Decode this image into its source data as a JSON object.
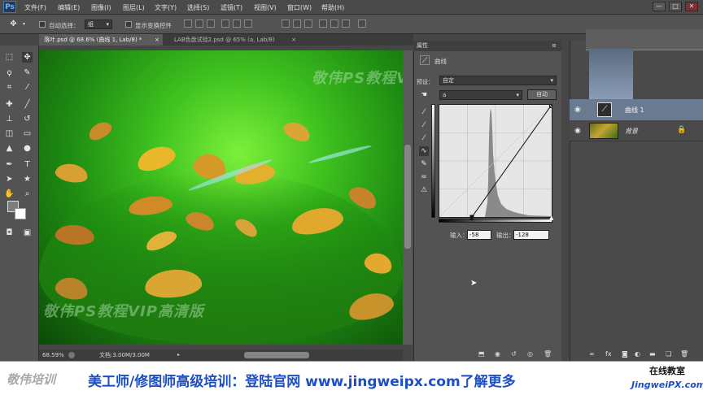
{
  "app": {
    "logo": "Ps"
  },
  "menu": [
    "文件(F)",
    "编辑(E)",
    "图像(I)",
    "图层(L)",
    "文字(Y)",
    "选择(S)",
    "滤镜(T)",
    "视图(V)",
    "窗口(W)",
    "帮助(H)"
  ],
  "window_buttons": [
    "—",
    "□",
    "✕"
  ],
  "options": {
    "auto_select_label": "自动选择：",
    "auto_select_value": "组",
    "show_transform_label": "显示变换控件"
  },
  "tabs": [
    {
      "label": "落叶.psd @ 68.6% (曲线 1, Lab/8) *",
      "close": "×"
    },
    {
      "label": "LAB色盘试验2.psd @ 65% (a, Lab/8)",
      "close": "×"
    }
  ],
  "canvas": {
    "watermark_top": "敬伟PS教程VIP高清版",
    "watermark_bottom": "敬伟PS教程VIP高清版"
  },
  "status": {
    "zoom": "68.59%",
    "doc": "文档:3.00M/3.00M"
  },
  "properties": {
    "panel_title": "属性",
    "panel_subtitle": "曲线",
    "preset_label": "预设：",
    "preset_value": "自定",
    "channel_value": "a",
    "auto_button": "自动",
    "input_label": "输入：",
    "input_value": "-58",
    "output_label": "输出：",
    "output_value": "-128"
  },
  "layers": [
    {
      "name": "曲线 1",
      "selected": true
    },
    {
      "name": "背景",
      "selected": false
    }
  ],
  "icons": {
    "eye": "eye-icon",
    "lock": "lock-icon",
    "move": "move-tool-icon"
  },
  "banner": {
    "logo_text": "敬伟培训",
    "main_text": "美工师/修图师高级培训：登陆官网 www.jingweipx.com了解更多",
    "right_top": "在线教室",
    "right_bottom": "JingweiPX.com"
  },
  "colors": {
    "selected_layer": "#6a7b91",
    "url_blue": "#1c4fc4"
  }
}
